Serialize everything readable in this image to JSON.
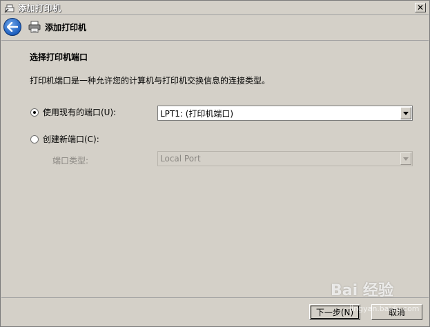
{
  "window": {
    "title": "添加打印机",
    "close_glyph": "✕"
  },
  "header": {
    "title": "添加打印机"
  },
  "content": {
    "section_title": "选择打印机端口",
    "description": "打印机端口是一种允许您的计算机与打印机交换信息的连接类型。",
    "options": [
      {
        "label": "使用现有的端口(U):",
        "selected": true
      },
      {
        "label": "创建新端口(C):",
        "selected": false
      }
    ],
    "existing_port_value": "LPT1: (打印机端口)",
    "port_type_label": "端口类型:",
    "port_type_value": "Local Port"
  },
  "footer": {
    "next_label": "下一步(N)",
    "cancel_label": "取消"
  },
  "watermark": {
    "brand": "Bai 经验",
    "url": "jingyan.baidu.com"
  },
  "colors": {
    "face": "#d4d0c8",
    "accent": "#1d5fbf"
  }
}
